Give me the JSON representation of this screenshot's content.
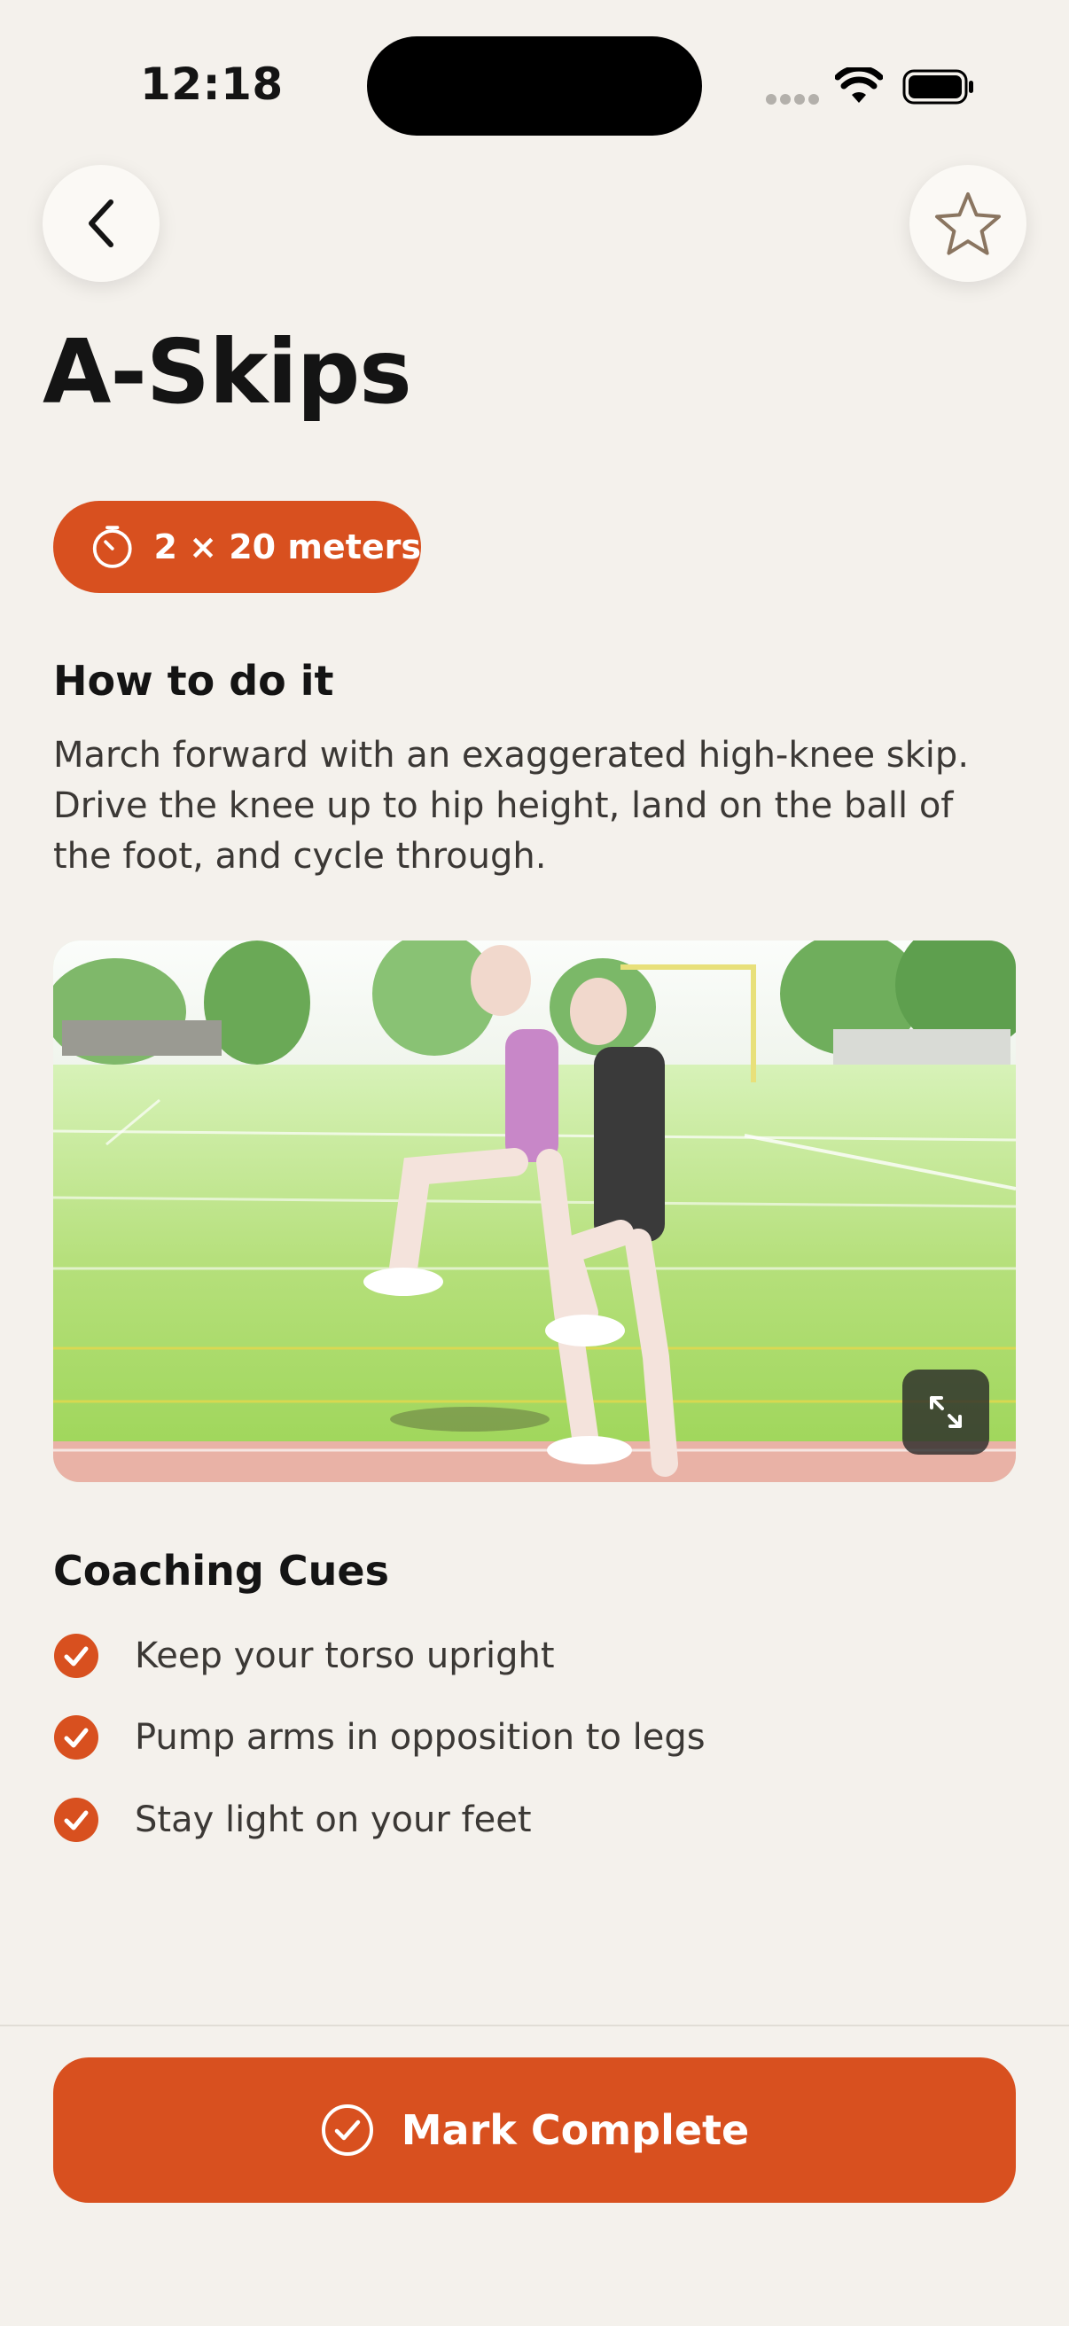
{
  "status_bar": {
    "time": "12:18"
  },
  "header": {
    "back_icon": "chevron-left-icon",
    "favorite_icon": "star-outline-icon"
  },
  "exercise": {
    "title": "A-Skips",
    "prescription": "2 × 20 meters",
    "prescription_icon": "timer-icon"
  },
  "instructions": {
    "heading": "How to do it",
    "text": "March forward with an exaggerated high-knee skip. Drive the knee up to hip height, land on the ball of the foot, and cycle through."
  },
  "media": {
    "expand_icon": "expand-icon"
  },
  "cues": {
    "heading": "Coaching Cues",
    "icon": "check-circle-icon",
    "items": [
      "Keep your torso upright",
      "Pump arms in opposition to legs",
      "Stay light on your feet"
    ]
  },
  "footer": {
    "complete_label": "Mark Complete",
    "complete_icon": "check-circle-outline-icon"
  },
  "colors": {
    "accent": "#d8501f",
    "background": "#f4f1ec",
    "text": "#141414",
    "body_text": "#3b3835"
  }
}
